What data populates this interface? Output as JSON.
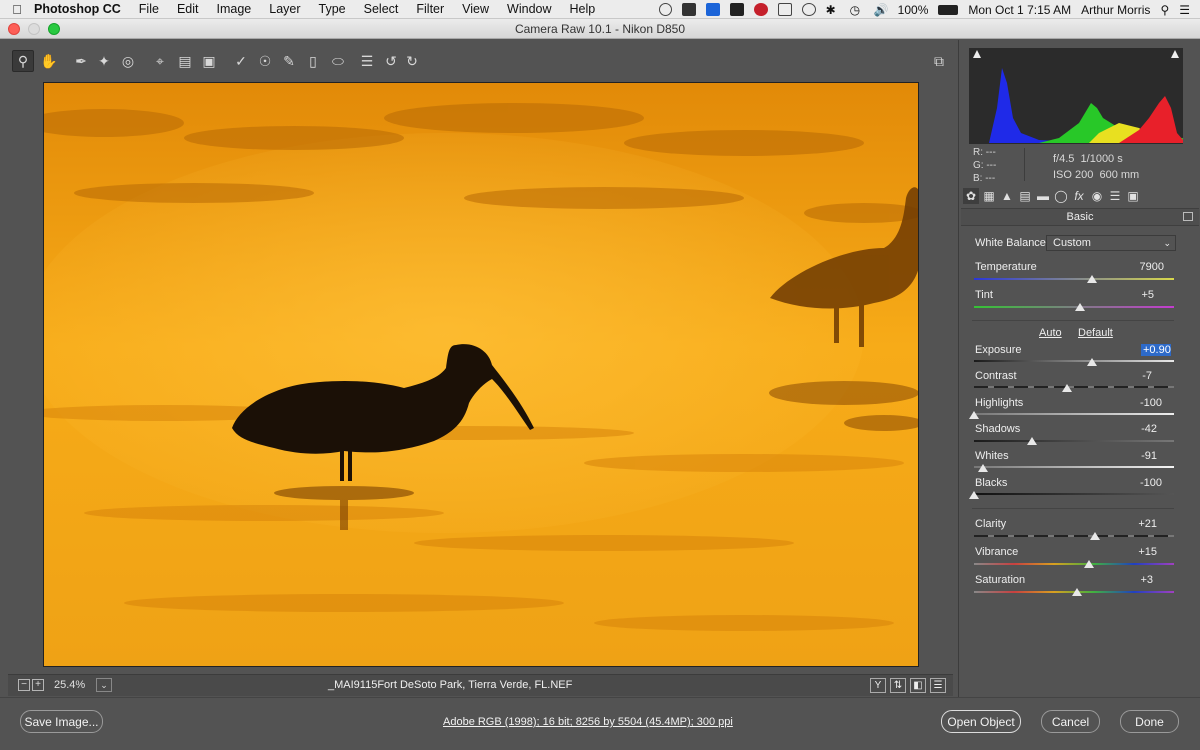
{
  "menubar": {
    "app_name": "Photoshop CC",
    "menus": [
      "File",
      "Edit",
      "Image",
      "Layer",
      "Type",
      "Select",
      "Filter",
      "View",
      "Window",
      "Help"
    ],
    "battery": "100%",
    "datetime": "Mon Oct 1  7:15 AM",
    "user": "Arthur Morris"
  },
  "window": {
    "title": "Camera Raw 10.1  -  Nikon D850"
  },
  "preview": {
    "zoom": "25.4%",
    "filename": "_MAI9115Fort DeSoto Park, Tierra Verde, FL.NEF",
    "view_buttons": [
      "Y",
      "⇅",
      "◧",
      "☰"
    ]
  },
  "readout": {
    "r": "R:  ---",
    "g": "G:  ---",
    "b": "B:  ---",
    "aperture": "f/4.5",
    "shutter": "1/1000 s",
    "iso": "ISO 200",
    "focal": "600 mm"
  },
  "basic": {
    "header": "Basic",
    "white_balance_label": "White Balance:",
    "white_balance_value": "Custom",
    "auto": "Auto",
    "default": "Default",
    "sliders": [
      {
        "label": "Temperature",
        "value": "7900",
        "position": 0.59
      },
      {
        "label": "Tint",
        "value": "+5",
        "position": 0.53
      },
      {
        "label": "Exposure",
        "value": "+0.90",
        "position": 0.59
      },
      {
        "label": "Contrast",
        "value": "-7",
        "position": 0.465
      },
      {
        "label": "Highlights",
        "value": "-100",
        "position": 0.0
      },
      {
        "label": "Shadows",
        "value": "-42",
        "position": 0.29
      },
      {
        "label": "Whites",
        "value": "-91",
        "position": 0.045
      },
      {
        "label": "Blacks",
        "value": "-100",
        "position": 0.0
      },
      {
        "label": "Clarity",
        "value": "+21",
        "position": 0.605
      },
      {
        "label": "Vibrance",
        "value": "+15",
        "position": 0.575
      },
      {
        "label": "Saturation",
        "value": "+3",
        "position": 0.515
      }
    ]
  },
  "footer": {
    "save": "Save Image...",
    "workflow": "Adobe RGB (1998); 16 bit; 8256 by 5504 (45.4MP); 300 ppi",
    "open": "Open Object",
    "cancel": "Cancel",
    "done": "Done"
  },
  "colors": {
    "panel_bg": "#535353",
    "histogram_bg": "#2b2b2b",
    "selection": "#2d6ac9",
    "photo_orange": "#f2a112"
  }
}
